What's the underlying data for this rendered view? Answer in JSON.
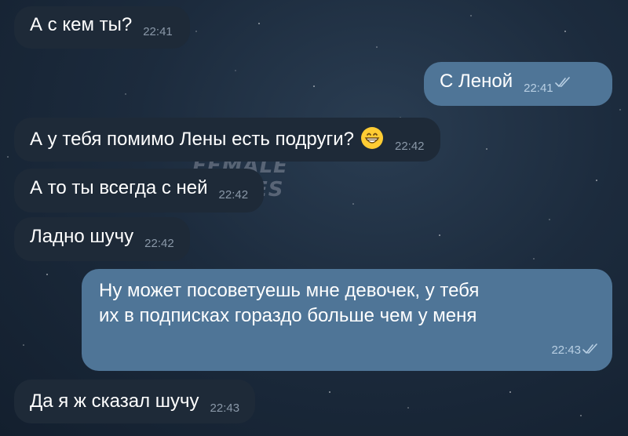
{
  "watermark": {
    "line1": "FEMALE",
    "line2": "MEMES"
  },
  "messages": [
    {
      "direction": "incoming",
      "text": "А с кем ты?",
      "time": "22:41"
    },
    {
      "direction": "outgoing",
      "text": "С Леной",
      "time": "22:41",
      "status": "read"
    },
    {
      "direction": "incoming",
      "text": "А у тебя помимо Лены есть подруги?",
      "emoji": "grinning-face",
      "time": "22:42"
    },
    {
      "direction": "incoming",
      "text": "А то ты всегда с ней",
      "time": "22:42"
    },
    {
      "direction": "incoming",
      "text": "Ладно шучу",
      "time": "22:42"
    },
    {
      "direction": "outgoing",
      "lines": [
        "Ну может посоветуешь мне девочек, у тебя",
        "их в подписках гораздо больше чем у меня"
      ],
      "time": "22:43",
      "status": "read"
    },
    {
      "direction": "incoming",
      "text": "Да я ж сказал шучу",
      "time": "22:43"
    }
  ],
  "colors": {
    "incoming_bubble": "#1e2a38",
    "outgoing_bubble": "#4f7597",
    "background": "#1c2b3d"
  }
}
